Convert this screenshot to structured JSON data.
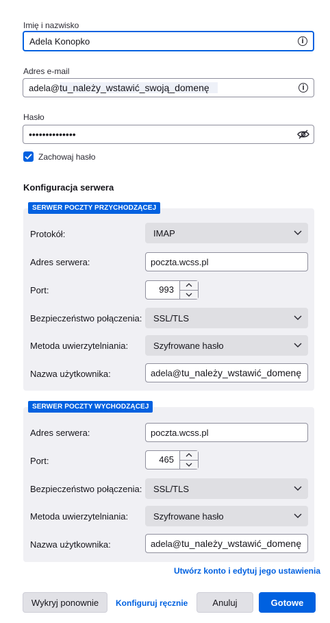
{
  "account": {
    "name_label": "Imię i nazwisko",
    "name_value": "Adela Konopko",
    "email_label": "Adres e-mail",
    "email_user": "adela@",
    "email_domain": "tu_należy_wstawić_swoją_domenę",
    "password_label": "Hasło",
    "password_value": "••••••••••••••",
    "remember_label": "Zachowaj hasło",
    "remember_checked": true
  },
  "server_config_title": "Konfiguracja serwera",
  "incoming": {
    "badge": "SERWER POCZTY PRZYCHODZĄCEJ",
    "protocol_label": "Protokół:",
    "protocol_value": "IMAP",
    "host_label": "Adres serwera:",
    "host_value": "poczta.wcss.pl",
    "port_label": "Port:",
    "port_value": "993",
    "security_label": "Bezpieczeństwo połączenia:",
    "security_value": "SSL/TLS",
    "auth_label": "Metoda uwierzytelniania:",
    "auth_value": "Szyfrowane hasło",
    "username_label": "Nazwa użytkownika:",
    "username_user": "adela@",
    "username_domain": "tu_należy_wstawić_domenę"
  },
  "outgoing": {
    "badge": "SERWER POCZTY WYCHODZĄCEJ",
    "host_label": "Adres serwera:",
    "host_value": "poczta.wcss.pl",
    "port_label": "Port:",
    "port_value": "465",
    "security_label": "Bezpieczeństwo połączenia:",
    "security_value": "SSL/TLS",
    "auth_label": "Metoda uwierzytelniania:",
    "auth_value": "Szyfrowane hasło",
    "username_label": "Nazwa użytkownika:",
    "username_user": "adela@",
    "username_domain": "tu_należy_wstawić_domenę"
  },
  "links": {
    "create_and_edit": "Utwórz konto i edytuj jego ustawienia",
    "manual_config": "Konfiguruj ręcznie"
  },
  "buttons": {
    "retest": "Wykryj ponownie",
    "cancel": "Anuluj",
    "done": "Gotowe"
  },
  "colors": {
    "accent": "#0061e0",
    "group_bg": "#f0f0f4",
    "select_bg": "#dfdfe3"
  },
  "icons": {
    "info": "info-icon",
    "show_password": "eye-slash-icon",
    "chevron": "chevron-down-icon",
    "check": "checkmark-icon"
  }
}
